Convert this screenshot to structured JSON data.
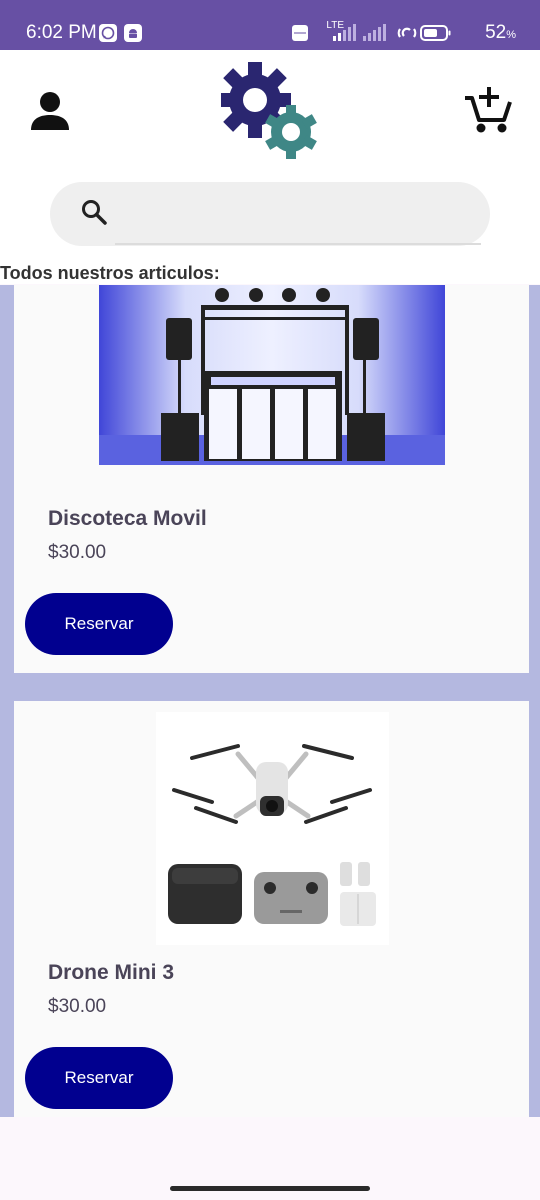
{
  "status_bar": {
    "time": "6:02 PM",
    "network": "LTE",
    "battery_percent": "52",
    "battery_unit": "%"
  },
  "header": {
    "user_icon": "person-icon",
    "logo": "gears-logo",
    "cart_icon": "add-to-cart-icon"
  },
  "search": {
    "placeholder": "",
    "value": "",
    "icon": "search-icon"
  },
  "section_title": "Todos nuestros articulos:",
  "products": [
    {
      "name": "Discoteca Movil",
      "price": "$30.00",
      "button_label": "Reservar"
    },
    {
      "name": "Drone Mini 3",
      "price": "$30.00",
      "button_label": "Reservar"
    }
  ],
  "colors": {
    "status_bar": "#6750a4",
    "list_background": "#b4b8e0",
    "button": "#01008f",
    "logo_primary": "#2a2670",
    "logo_secondary": "#3f8786"
  }
}
